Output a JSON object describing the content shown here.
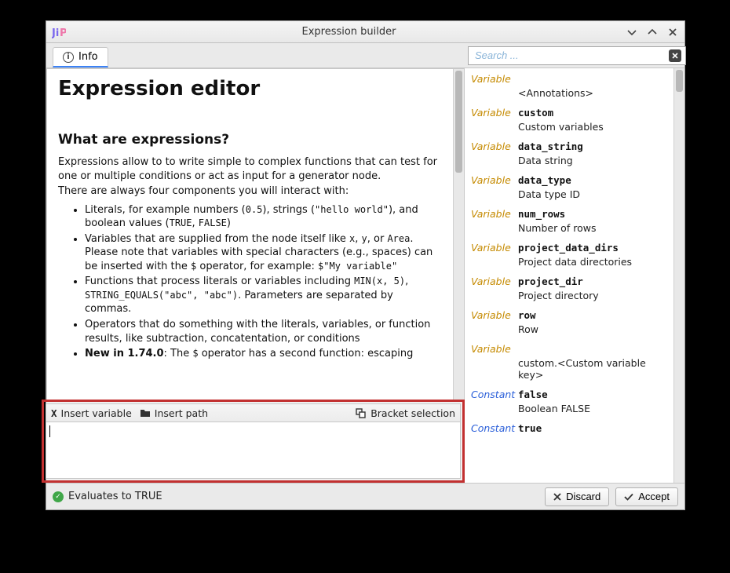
{
  "window": {
    "title": "Expression builder"
  },
  "tab": {
    "info_label": "Info"
  },
  "help": {
    "h1": "Expression editor",
    "h2": "What are expressions?",
    "p1": "Expressions allow to to write simple to complex functions that can test for one or multiple conditions or act as input for a generator node.",
    "p2": "There are always four components you will interact with:",
    "li1_a": "Literals, for example numbers (",
    "li1_code1": "0.5",
    "li1_b": "), strings (",
    "li1_code2": "\"hello world\"",
    "li1_c": "), and boolean values (",
    "li1_code3": "TRUE",
    "li1_d": ", ",
    "li1_code4": "FALSE",
    "li1_e": ")",
    "li2_a": "Variables that are supplied from the node itself like ",
    "li2_code1": "x",
    "li2_b": ", ",
    "li2_code2": "y",
    "li2_c": ", or ",
    "li2_code3": "Area",
    "li2_d": ". Please note that variables with special characters (e.g., spaces) can be inserted with the ",
    "li2_code4": "$",
    "li2_e": " operator, for example: ",
    "li2_code5": "$\"My variable\"",
    "li3_a": "Functions that process literals or variables including ",
    "li3_code1": "MIN(x, 5)",
    "li3_b": ", ",
    "li3_code2": "STRING_EQUALS(\"abc\", \"abc\")",
    "li3_c": ". Parameters are separated by commas.",
    "li4": "Operators that do something with the literals, variables, or function results, like subtraction, concatentation, or conditions",
    "li5_a": "New in 1.74.0",
    "li5_b": ": The ",
    "li5_code1": "$",
    "li5_c": " operator has a second function: escaping"
  },
  "toolbar": {
    "insert_variable": "Insert variable",
    "insert_path": "Insert path",
    "bracket_selection": "Bracket selection"
  },
  "search": {
    "placeholder": "Search ..."
  },
  "ref": [
    {
      "kind": "Variable",
      "name": "",
      "desc": "<Annotations>"
    },
    {
      "kind": "Variable",
      "name": "custom",
      "desc": "Custom variables"
    },
    {
      "kind": "Variable",
      "name": "data_string",
      "desc": "Data string"
    },
    {
      "kind": "Variable",
      "name": "data_type",
      "desc": "Data type ID"
    },
    {
      "kind": "Variable",
      "name": "num_rows",
      "desc": "Number of rows"
    },
    {
      "kind": "Variable",
      "name": "project_data_dirs",
      "desc": "Project data directories"
    },
    {
      "kind": "Variable",
      "name": "project_dir",
      "desc": "Project directory"
    },
    {
      "kind": "Variable",
      "name": "row",
      "desc": "Row"
    },
    {
      "kind": "Variable",
      "name": "",
      "desc": "custom.<Custom variable key>"
    },
    {
      "kind": "Constant",
      "name": "false",
      "desc": "Boolean FALSE"
    },
    {
      "kind": "Constant",
      "name": "true",
      "desc": ""
    }
  ],
  "footer": {
    "status": "Evaluates to TRUE",
    "discard": "Discard",
    "accept": "Accept"
  }
}
